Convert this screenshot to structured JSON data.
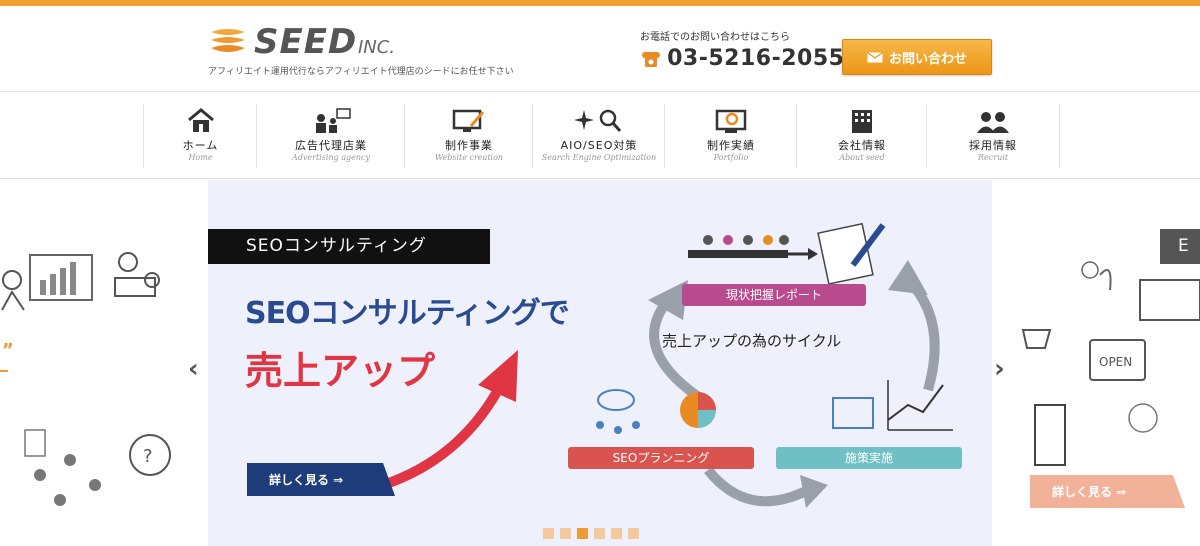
{
  "header": {
    "logo_text": "SEED",
    "logo_suffix": "INC.",
    "tagline": "アフィリエイト運用代行ならアフィリエイト代理店のシードにお任せ下さい",
    "contact_caption": "お電話でのお問い合わせはこちら",
    "phone": "03-5216-2055",
    "inquiry_button": "お問い合わせ",
    "accent_color": "#f0a030"
  },
  "nav": {
    "items": [
      {
        "label": "ホーム",
        "en": "Home",
        "icon": "home-icon"
      },
      {
        "label": "広告代理店業",
        "en": "Advertising agency",
        "icon": "agency-icon"
      },
      {
        "label": "制作事業",
        "en": "Website creation",
        "icon": "monitor-pen-icon"
      },
      {
        "label": "AIO/SEO対策",
        "en": "Search Engine Optimization",
        "icon": "seo-search-icon"
      },
      {
        "label": "制作実績",
        "en": "Portfolio",
        "icon": "portfolio-icon"
      },
      {
        "label": "会社情報",
        "en": "About seed",
        "icon": "building-icon"
      },
      {
        "label": "採用情報",
        "en": "Recruit",
        "icon": "people-icon"
      }
    ]
  },
  "slider": {
    "slide_title": "SEOコンサルティング",
    "headline_line1": "SEOコンサルティングで",
    "headline_line2": "売上アップ",
    "detail_button": "詳しく見る ⇒",
    "cycle_label": "売上アップの為のサイクル",
    "steps": {
      "report": "現状把握レポート",
      "planning": "SEOプランニング",
      "execution": "施策実施"
    },
    "next_slide_tab": "E",
    "next_detail_button": "詳しく見る ⇒",
    "prev_arrow": "‹",
    "next_arrow": "›",
    "dots_count": 6,
    "active_dot": 3,
    "colors": {
      "headline_blue": "#2a4b8f",
      "headline_red": "#e03542",
      "report_pill": "#b84a8e",
      "planning_pill": "#d9534f",
      "execution_pill": "#6ec0c4"
    }
  }
}
